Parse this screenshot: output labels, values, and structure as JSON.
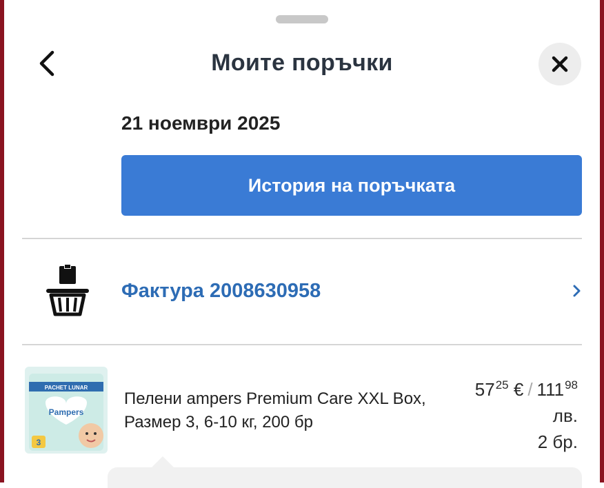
{
  "header": {
    "title": "Моите поръчки",
    "back_icon": "chevron-left-icon",
    "close_icon": "close-icon"
  },
  "order": {
    "date": "21 ноември 2025",
    "history_button_label": "История на поръчката"
  },
  "invoice": {
    "label": "Фактура 2008630958",
    "icon": "basket-icon",
    "chevron_icon": "chevron-right-icon"
  },
  "product": {
    "name": "Пелени ampers Premium Care XXL Box, Размер 3, 6-10 кг, 200 бр",
    "price_eur_main": "57",
    "price_eur_cents": "25",
    "currency_eur": "€",
    "price_sep": "/",
    "price_bgn_main": "111",
    "price_bgn_cents": "98",
    "currency_bgn": "лв.",
    "quantity": "2 бр.",
    "image_label_top": "PACHET LUNAR",
    "image_brand": "Pampers",
    "image_size": "3"
  },
  "colors": {
    "accent": "#3a7bd5",
    "link": "#2d6cb5",
    "edge": "#8a1320"
  }
}
